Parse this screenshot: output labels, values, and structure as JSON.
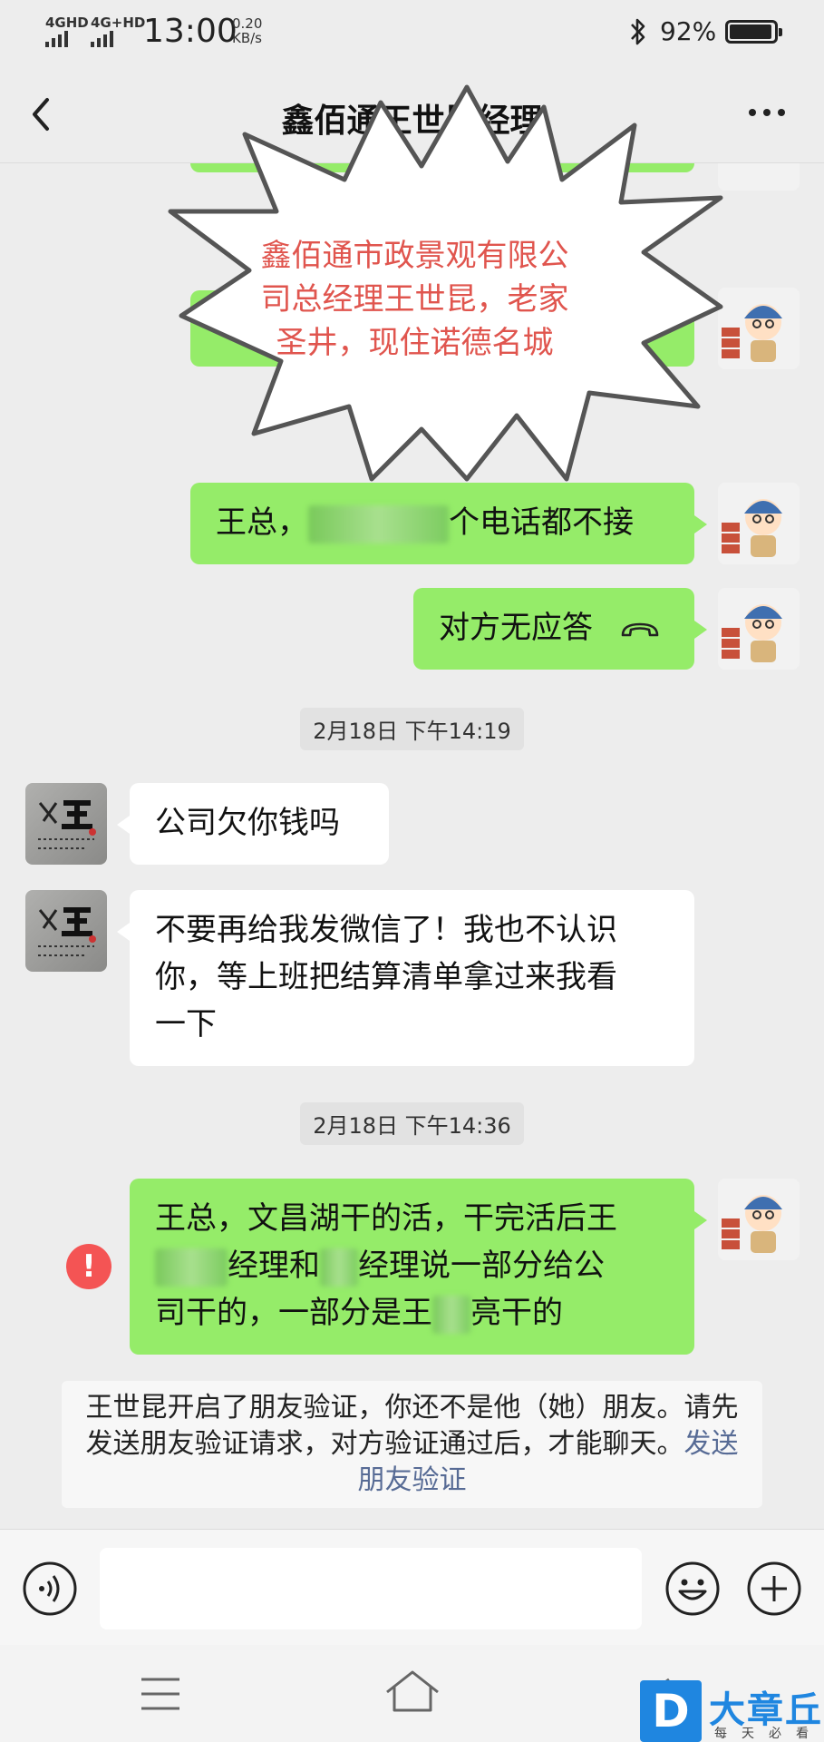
{
  "status_bar": {
    "net1": "4GHD",
    "net2": "4G+HD",
    "time": "13:00",
    "speed_value": "0.20",
    "speed_unit": "KB/s",
    "battery_percent": "92%",
    "bluetooth_icon": "bluetooth-icon",
    "battery_icon": "battery-icon"
  },
  "nav": {
    "title": "鑫佰通王世昆经理",
    "back_icon": "chevron-left-icon",
    "more_icon": "more-icon"
  },
  "annotation": {
    "line1": "鑫佰通市政景观有限公",
    "line2": "司总经理王世昆，老家",
    "line3": "圣井，现住诺德名城"
  },
  "messages": {
    "m1_prefix": "王总，",
    "m1_suffix": "个电话都不接",
    "m2_text": "对方无应答",
    "time1": "2月18日 下午14:19",
    "m3_text": "公司欠你钱吗",
    "m4_line1": "不要再给我发微信了！我也不认识",
    "m4_line2": "你，等上班把结算清单拿过来我看",
    "m4_line3": "一下",
    "time2": "2月18日 下午14:36",
    "m5_line1": "王总，文昌湖干的活，干完活后王",
    "m5_line2": "经理和",
    "m5_line2b": "经理说一部分给公",
    "m5_line3a": "司干的，一部分是王",
    "m5_line3b": "亮干的",
    "error_mark": "!"
  },
  "notice": {
    "text": "王世昆开启了朋友验证，你还不是他（她）朋友。请先发送朋友验证请求，对方验证通过后，才能聊天。",
    "link": "发送朋友验证"
  },
  "input_bar": {
    "voice_icon": "voice-icon",
    "emoji_icon": "emoji-icon",
    "plus_icon": "plus-icon"
  },
  "system_nav": {
    "menu_icon": "menu-icon",
    "home_icon": "home-icon",
    "back_icon": "back-icon"
  },
  "watermark": {
    "logo": "D",
    "name": "大章丘",
    "sub": "每天必看"
  }
}
